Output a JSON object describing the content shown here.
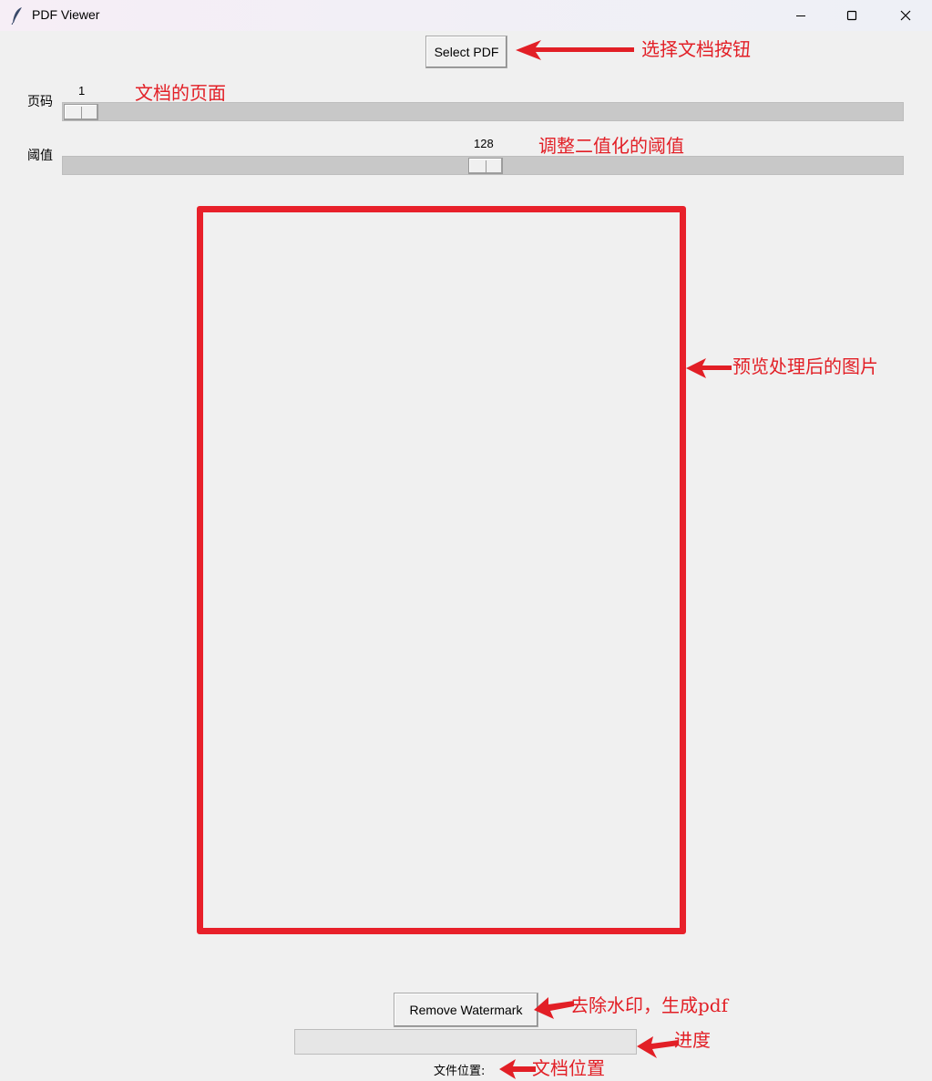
{
  "window": {
    "title": "PDF Viewer",
    "icon": "feather-icon"
  },
  "toolbar": {
    "select_pdf_label": "Select PDF"
  },
  "page_slider": {
    "label": "页码",
    "value": "1",
    "value_fraction": 0.0
  },
  "threshold_slider": {
    "label": "阈值",
    "value": "128",
    "value_fraction": 0.5
  },
  "actions": {
    "remove_watermark_label": "Remove Watermark"
  },
  "progress": {
    "value_fraction": 0.0
  },
  "file_location": {
    "label": "文件位置:"
  },
  "annotations": {
    "select_button": "选择文档按钮",
    "page": "文档的页面",
    "threshold": "调整二值化的阈值",
    "preview": "预览处理后的图片",
    "remove_watermark": "去除水印，生成pdf",
    "progress": "进度",
    "file_location": "文档位置"
  },
  "colors": {
    "annotation": "#e21f26",
    "background": "#f0f0f0",
    "trough": "#c8c8c8"
  }
}
